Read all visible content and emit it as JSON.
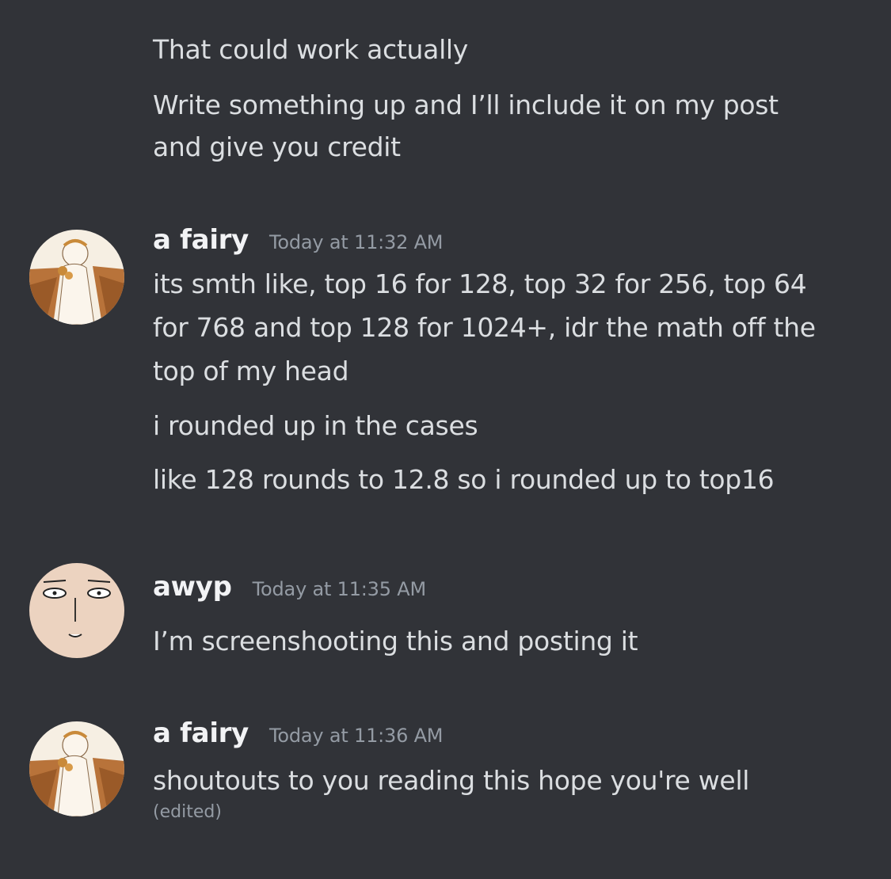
{
  "messages": {
    "continued": {
      "line1": "That could work actually",
      "line2a": "Write something up and I’ll include it on my post",
      "line2b": "and give you credit"
    },
    "fairy1": {
      "username": "a fairy",
      "timestamp": "Today at 11:32 AM",
      "line1": "its smth like, top 16 for 128, top 32 for 256, top 64",
      "line2": "for 768 and top 128 for 1024+, idr the math off the",
      "line3": "top of my head",
      "line4": "i rounded up in the cases",
      "line5": "like 128 rounds to 12.8 so i rounded up to top16"
    },
    "awyp": {
      "username": "awyp",
      "timestamp": "Today at 11:35 AM",
      "line1": "I’m screenshooting this and posting it"
    },
    "fairy2": {
      "username": "a fairy",
      "timestamp": "Today at 11:36 AM",
      "line1": "shoutouts to you reading this hope you're well",
      "edited": "(edited)"
    }
  },
  "colors": {
    "background": "#313338",
    "text": "#dbdee1",
    "username": "#f2f3f5",
    "muted": "#949ba4"
  },
  "icons": {
    "fairy_avatar": "angel-illustration-avatar",
    "awyp_avatar": "bald-face-avatar"
  }
}
